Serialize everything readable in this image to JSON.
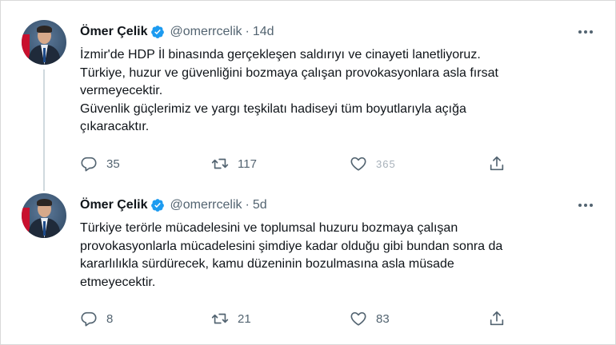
{
  "tweets": [
    {
      "author_name": "Ömer Çelik",
      "handle": "@omerrcelik",
      "separator": "·",
      "time": "14d",
      "text_lines": [
        "İzmir'de HDP İl binasında gerçekleşen saldırıyı ve cinayeti lanetliyoruz.",
        "Türkiye, huzur ve güvenliğini bozmaya çalışan provokasyonlara asla fırsat",
        "vermeyecektir.",
        "Güvenlik güçlerimiz ve yargı teşkilatı hadiseyi tüm boyutlarıyla açığa",
        "çıkaracaktır."
      ],
      "replies": "35",
      "retweets": "117",
      "likes": "365"
    },
    {
      "author_name": "Ömer Çelik",
      "handle": "@omerrcelik",
      "separator": "·",
      "time": "5d",
      "text_lines": [
        "Türkiye terörle mücadelesini ve toplumsal huzuru bozmaya çalışan",
        "provokasyonlarla mücadelesini şimdiye kadar olduğu gibi bundan sonra da",
        "kararlılıkla sürdürecek, kamu düzeninin bozulmasına asla müsade",
        "etmeyecektir."
      ],
      "replies": "8",
      "retweets": "21",
      "likes": "83"
    }
  ],
  "icons": {
    "verified": "verified-badge-icon",
    "more": "more-options-icon",
    "reply": "reply-icon",
    "retweet": "retweet-icon",
    "like": "like-icon",
    "share": "share-icon"
  },
  "colors": {
    "verified": "#1d9bf0",
    "muted_text": "#536471",
    "thread_line": "#cfd9de"
  }
}
